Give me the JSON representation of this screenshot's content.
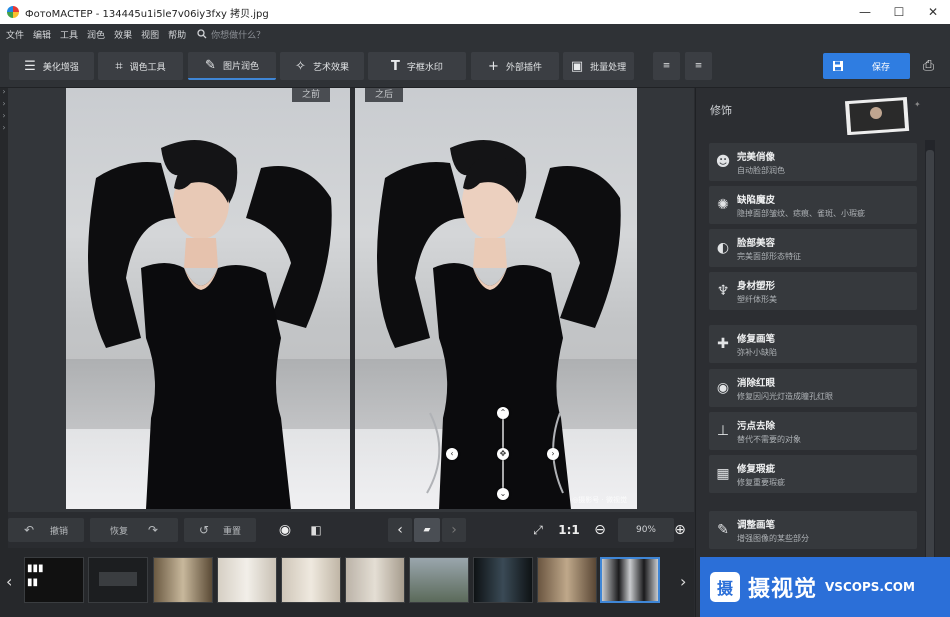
{
  "window": {
    "title": "ФотоМАСТЕР - 134445u1i5le7v06iy3fxy 拷贝.jpg",
    "controls": [
      "—",
      "☐",
      "✕"
    ]
  },
  "menu": {
    "items": [
      "文件",
      "编辑",
      "工具",
      "润色",
      "效果",
      "视图",
      "帮助"
    ],
    "search_placeholder": "你想做什么？"
  },
  "toolbar": {
    "tabs": [
      {
        "label": "美化增强",
        "icon": "sliders-icon"
      },
      {
        "label": "调色工具",
        "icon": "crop-icon"
      },
      {
        "label": "图片润色",
        "icon": "brush-icon",
        "active": true
      },
      {
        "label": "艺术效果",
        "icon": "magic-wand-icon"
      },
      {
        "label": "字框水印",
        "icon": "text-icon"
      },
      {
        "label": "外部插件",
        "icon": "plus-icon"
      },
      {
        "label": "批量处理",
        "icon": "image-icon"
      }
    ],
    "save_label": "保存",
    "accent": "#2f7de1"
  },
  "preview": {
    "before_label": "之前",
    "after_label": "之后",
    "watermark": "◎摄影号 · 微视觉"
  },
  "bottombar": {
    "undo_label": "撤销",
    "redo_label": "恢复",
    "reset_label": "重置",
    "zoom_ratio": "1:1",
    "zoom_value": "90%"
  },
  "filmstrip": {
    "thumb_count": 10
  },
  "rightpanel": {
    "title": "修饰",
    "tools": [
      {
        "name": "完美俏像",
        "desc": "自动脸部润色",
        "icon": "face-icon"
      },
      {
        "name": "缺陷魔皮",
        "desc": "隐掉面部皱纹、痣痕、雀斑、小瑕疵",
        "icon": "bulb-icon"
      },
      {
        "name": "脸部美容",
        "desc": "完美面部形态特征",
        "icon": "face-shape-icon"
      },
      {
        "name": "身材塑形",
        "desc": "塑纤体形美",
        "icon": "body-icon"
      },
      {
        "name": "修复画笔",
        "desc": "弥补小缺陷",
        "icon": "bandage-icon"
      },
      {
        "name": "消除红眼",
        "desc": "修复因闪光灯造成瞳孔红眼",
        "icon": "eye-icon"
      },
      {
        "name": "污点去除",
        "desc": "替代不需要的对象",
        "icon": "stamp-icon"
      },
      {
        "name": "修复瑕疵",
        "desc": "修复重要瑕疵",
        "icon": "patch-icon"
      },
      {
        "name": "调整画笔",
        "desc": "增强图像的某些部分",
        "icon": "adjust-brush-icon"
      }
    ]
  },
  "brand": {
    "logo": "摄",
    "name": "摄视觉",
    "url": "VSCOPS.COM",
    "color": "#2b6fd8"
  }
}
